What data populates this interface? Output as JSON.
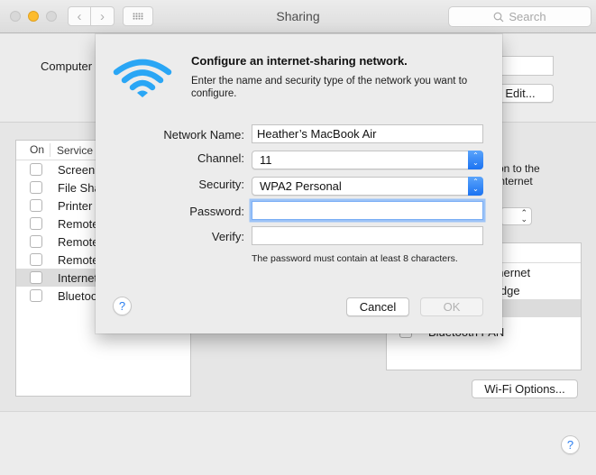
{
  "window": {
    "title": "Sharing",
    "search_placeholder": "Search",
    "back_glyph": "‹",
    "forward_glyph": "›"
  },
  "computer_name": {
    "label": "Computer",
    "edit_label": "Edit..."
  },
  "services": {
    "header_on": "On",
    "header_service": "Service",
    "items": [
      {
        "name": "Screen Sharing",
        "visible_text": "Screen",
        "checked": false,
        "selected": false
      },
      {
        "name": "File Sharing",
        "visible_text": "File Sha",
        "checked": false,
        "selected": false
      },
      {
        "name": "Printer Sharing",
        "visible_text": "Printer",
        "checked": false,
        "selected": false
      },
      {
        "name": "Remote Login",
        "visible_text": "Remote",
        "checked": false,
        "selected": false
      },
      {
        "name": "Remote Management",
        "visible_text": "Remote",
        "checked": false,
        "selected": false
      },
      {
        "name": "Remote Apple Events",
        "visible_text": "Remote",
        "checked": false,
        "selected": false
      },
      {
        "name": "Internet Sharing",
        "visible_text": "Internet",
        "checked": false,
        "selected": true
      },
      {
        "name": "Bluetooth Sharing",
        "visible_text": "Bluetoo",
        "checked": false,
        "selected": false
      }
    ]
  },
  "internet_sharing": {
    "description_line1": "ction to the",
    "description_line2": "e Internet",
    "ports": [
      {
        "visible_text": "Ethernet",
        "checkbox_visible": false,
        "selected": false
      },
      {
        "visible_text": "Bridge",
        "checkbox_visible": false,
        "selected": false
      },
      {
        "visible_text": "",
        "checkbox_visible": false,
        "selected": true
      },
      {
        "visible_text": "Bluetooth PAN",
        "checkbox_visible": true,
        "checked": false,
        "selected": false
      }
    ],
    "wifi_options_label": "Wi-Fi Options..."
  },
  "help_glyph": "?",
  "dialog": {
    "icon": "wifi-icon",
    "title": "Configure an internet-sharing network.",
    "description": "Enter the name and security type of the network you want to configure.",
    "fields": {
      "network_name_label": "Network Name:",
      "network_name_value": "Heather’s MacBook Air",
      "channel_label": "Channel:",
      "channel_value": "11",
      "security_label": "Security:",
      "security_value": "WPA2 Personal",
      "password_label": "Password:",
      "password_value": "",
      "verify_label": "Verify:",
      "verify_value": ""
    },
    "hint": "The password must contain at least 8 characters.",
    "cancel_label": "Cancel",
    "ok_label": "OK",
    "ok_enabled": false
  },
  "colors": {
    "accent": "#1b73f2",
    "wifi_icon": "#2aa6f5",
    "minimize_light": "#fdbc2e"
  }
}
